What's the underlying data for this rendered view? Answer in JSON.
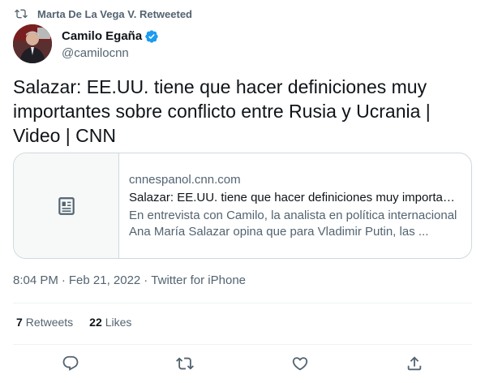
{
  "retweet": {
    "icon": "retweet-icon",
    "label": "Marta De La Vega V. Retweeted"
  },
  "author": {
    "name": "Camilo Egaña",
    "handle": "@camilocnn",
    "verified_icon": "verified-badge-icon",
    "verified_color": "#1d9bf0"
  },
  "tweet": {
    "text": "Salazar: EE.UU. tiene que hacer definiciones muy importantes sobre conflicto entre Rusia y Ucrania | Video | CNN"
  },
  "card": {
    "thumb_icon": "article-icon",
    "domain": "cnnespanol.cnn.com",
    "title": "Salazar: EE.UU. tiene que hacer definiciones muy importantes sobre conflicto entre Rusia y Ucrania | Video | CNN",
    "description": "En entrevista con Camilo, la analista en política internacional Ana María Salazar opina que para Vladimir Putin, las ..."
  },
  "meta": {
    "time": "8:04 PM",
    "date": "Feb 21, 2022",
    "source": "Twitter for iPhone",
    "separator": "·"
  },
  "stats": {
    "retweets_count": "7",
    "retweets_label": "Retweets",
    "likes_count": "22",
    "likes_label": "Likes"
  },
  "actions": [
    "reply-icon",
    "retweet-icon",
    "like-icon",
    "share-icon"
  ],
  "colors": {
    "text_primary": "#0f1419",
    "text_secondary": "#536471",
    "border": "#cfd9de",
    "divider": "#eff3f4"
  }
}
